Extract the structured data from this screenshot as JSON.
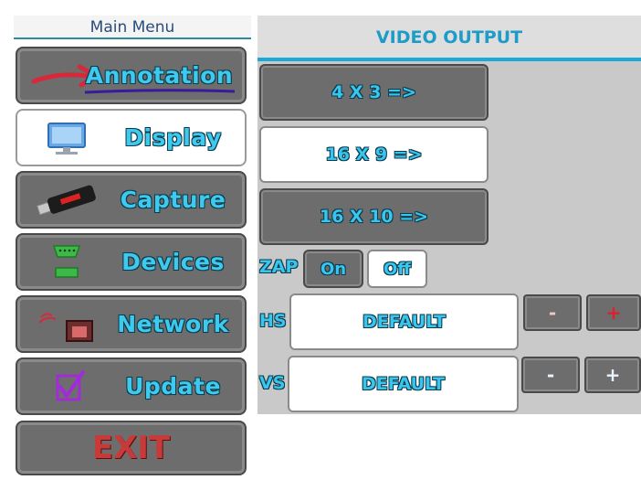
{
  "menu": {
    "title": "Main Menu",
    "items": [
      {
        "label": "Annotation",
        "icon": "arrow-icon"
      },
      {
        "label": "Display",
        "icon": "monitor-icon"
      },
      {
        "label": "Capture",
        "icon": "usb-drive-icon"
      },
      {
        "label": "Devices",
        "icon": "serial-port-icon"
      },
      {
        "label": "Network",
        "icon": "network-port-icon"
      },
      {
        "label": "Update",
        "icon": "checkbox-icon"
      }
    ],
    "exit_label": "EXIT"
  },
  "video_output": {
    "title": "VIDEO OUTPUT",
    "aspect_buttons": [
      "4 X 3 =>",
      "16 X 9 =>",
      "16 X 10 =>"
    ],
    "selected_aspect": "16 X 9 =>",
    "zap": {
      "label": "ZAP",
      "on_label": "On",
      "off_label": "Off",
      "selected": "Off"
    },
    "hs": {
      "label": "HS",
      "value": "DEFAULT",
      "minus": "-",
      "plus": "+"
    },
    "vs": {
      "label": "VS",
      "value": "DEFAULT",
      "minus": "-",
      "plus": "+"
    }
  },
  "colors": {
    "accent": "#1aa9d8",
    "label": "#39c6ee",
    "exit": "#c83a3a",
    "plus_red": "#e0202a"
  }
}
